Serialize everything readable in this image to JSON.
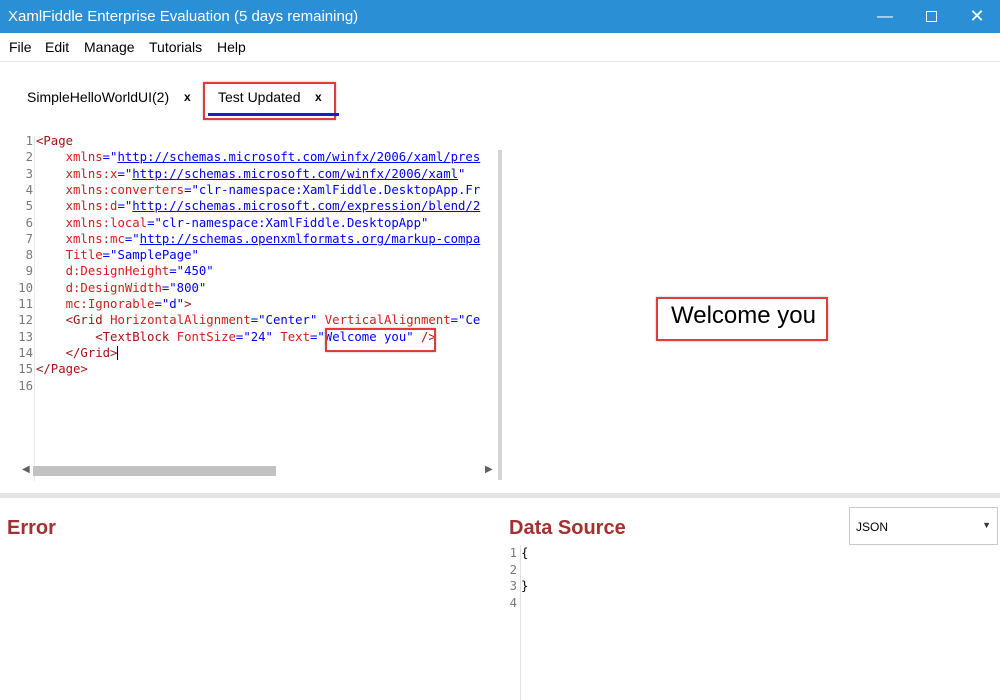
{
  "window": {
    "title": "XamlFiddle Enterprise Evaluation (5 days remaining)",
    "minimize_icon": "minimize-icon",
    "maximize_icon": "maximize-icon",
    "close_icon": "close-icon",
    "minimize_glyph": "—",
    "close_glyph": "✕"
  },
  "menu": {
    "file": "File",
    "edit": "Edit",
    "manage": "Manage",
    "tutorials": "Tutorials",
    "help": "Help"
  },
  "tabs": [
    {
      "label": "SimpleHelloWorldUI(2)",
      "close": "x",
      "active": false
    },
    {
      "label": "Test Updated",
      "close": "x",
      "active": true
    }
  ],
  "editor": {
    "line_numbers": [
      "1",
      "2",
      "3",
      "4",
      "5",
      "6",
      "7",
      "8",
      "9",
      "10",
      "11",
      "12",
      "13",
      "14",
      "15",
      "16"
    ],
    "l1_tag": "<Page",
    "l2_attr": "xmlns",
    "l2_eq": "=\"",
    "l2_link": "http://schemas.microsoft.com/winfx/2006/xaml/pres",
    "l3_attr": "xmlns:x",
    "l3_eq": "=\"",
    "l3_link": "http://schemas.microsoft.com/winfx/2006/xaml",
    "l3_end": "\"",
    "l4_attr": "xmlns:converters",
    "l4_val": "=\"clr-namespace:XamlFiddle.DesktopApp.Fr",
    "l5_attr": "xmlns:d",
    "l5_eq": "=\"",
    "l5_link": "http://schemas.microsoft.com/expression/blend/2",
    "l6_attr": "xmlns:local",
    "l6_val": "=\"clr-namespace:XamlFiddle.DesktopApp\"",
    "l7_attr": "xmlns:mc",
    "l7_eq": "=\"",
    "l7_link": "http://schemas.openxmlformats.org/markup-compa",
    "l8_attr": "Title",
    "l8_val": "=\"SamplePage\"",
    "l9_attr": "d:DesignHeight",
    "l9_val": "=\"450\"",
    "l10_attr": "d:DesignWidth",
    "l10_val": "=\"800\"",
    "l11_attr": "mc:Ignorable",
    "l11_val": "=\"d\"",
    "l11_end": ">",
    "l12_tag": "<Grid",
    "l12_attr1": "HorizontalAlignment",
    "l12_val1": "=\"Center\"",
    "l12_attr2": "VerticalAlignment",
    "l12_val2": "=\"Ce",
    "l13_tag": "<TextBlock",
    "l13_attr1": "FontSize",
    "l13_val1": "=\"24\"",
    "l13_attr2": "Text",
    "l13_eq": "=",
    "l13_val2": "\"Welcome you\"",
    "l13_end": "/>",
    "l14_tag": "</Grid>",
    "l15_tag": "</Page>"
  },
  "preview": {
    "text": "Welcome you"
  },
  "error_panel": {
    "title": "Error"
  },
  "data_source": {
    "title": "Data Source",
    "format_selected": "JSON",
    "dropdown_icon": "chevron-down-icon",
    "dropdown_glyph": "▼",
    "line_numbers": [
      "1",
      "2",
      "3",
      "4"
    ],
    "lines": [
      "{",
      "",
      "}",
      ""
    ]
  },
  "scrollbar": {
    "left_arrow": "◀",
    "right_arrow": "▶"
  },
  "colors": {
    "titlebar": "#2b8fd6",
    "highlight": "#e53a3a",
    "tab_underline": "#1a1adb",
    "panel_title": "#a33131"
  }
}
